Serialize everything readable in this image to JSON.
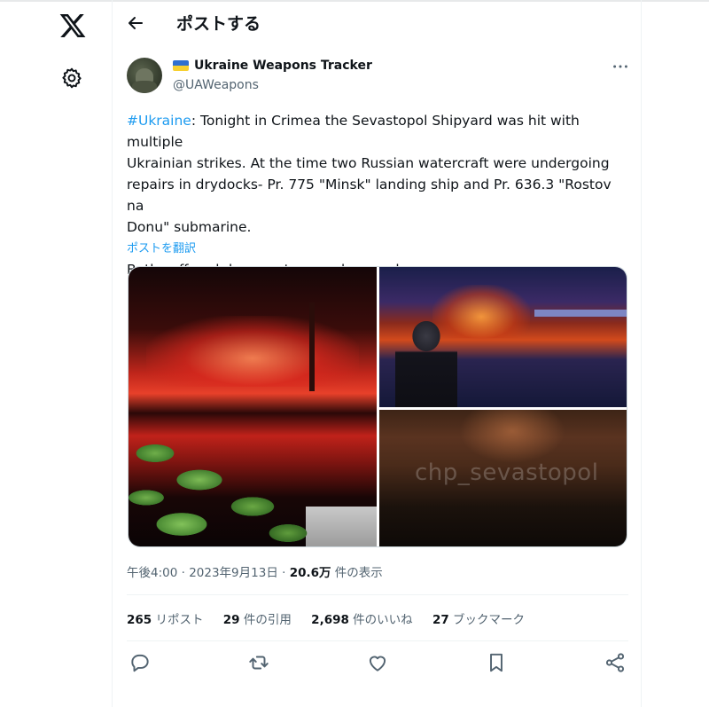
{
  "nav": {
    "x_logo_icon": "x-logo-icon",
    "settings_icon": "gear-icon"
  },
  "header": {
    "back_icon": "arrow-left-icon",
    "title": "ポストする"
  },
  "author": {
    "avatar_icon": "avatar",
    "flag_icon": "ukraine-flag-icon",
    "display_name": "Ukraine Weapons Tracker",
    "handle": "@UAWeapons",
    "more_icon": "more-horizontal-icon"
  },
  "tweet": {
    "hashtag": "#Ukraine",
    "text": ": Tonight in Crimea the Sevastopol Shipyard was hit with multiple\nUkrainian strikes. At the time two Russian watercraft were undergoing\nrepairs in drydocks- Pr. 775 \"Minsk\" landing ship and Pr. 636.3 \"Rostov na\nDonu\" submarine.\n\nBoth suffered damage to an unknown degree.",
    "translate_label": "ポストを翻訳"
  },
  "media": {
    "watermark": "chp_sevastopol"
  },
  "meta": {
    "time": "午後4:00",
    "sep1": " · ",
    "date": "2023年9月13日",
    "sep2": " · ",
    "views_count": "20.6万",
    "views_label": " 件の表示"
  },
  "stats": [
    {
      "count": "265",
      "label": " リポスト"
    },
    {
      "count": "29",
      "label": " 件の引用"
    },
    {
      "count": "2,698",
      "label": " 件のいいね"
    },
    {
      "count": "27",
      "label": " ブックマーク"
    }
  ],
  "actions": {
    "reply_icon": "reply-icon",
    "repost_icon": "repost-icon",
    "like_icon": "heart-icon",
    "bookmark_icon": "bookmark-icon",
    "share_icon": "share-icon"
  },
  "colors": {
    "accent": "#1d9bf0",
    "text": "#0f1419",
    "secondary": "#536471",
    "border": "#eff3f4"
  }
}
